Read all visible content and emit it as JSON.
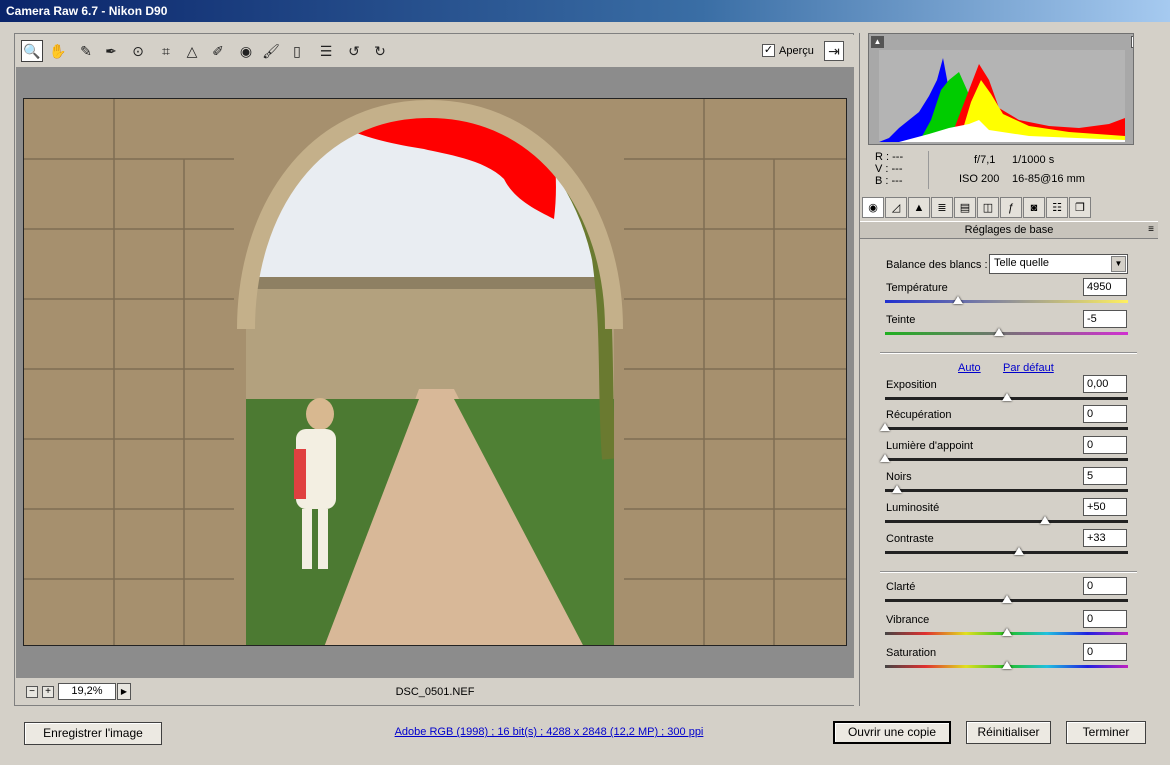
{
  "window": {
    "title": "Camera Raw 6.7  -  Nikon D90"
  },
  "toolbar": {
    "tools": [
      {
        "name": "zoom-tool-icon",
        "glyph": "🔍"
      },
      {
        "name": "hand-tool-icon",
        "glyph": "✋"
      },
      {
        "name": "white-balance-tool-icon",
        "glyph": "✎"
      },
      {
        "name": "color-sampler-tool-icon",
        "glyph": "✒"
      },
      {
        "name": "targeted-adjustment-tool-icon",
        "glyph": "⊙"
      },
      {
        "name": "crop-tool-icon",
        "glyph": "⌗"
      },
      {
        "name": "straighten-tool-icon",
        "glyph": "△"
      },
      {
        "name": "spot-removal-tool-icon",
        "glyph": "✐"
      },
      {
        "name": "red-eye-tool-icon",
        "glyph": "◉"
      },
      {
        "name": "adjustment-brush-icon",
        "glyph": "🖌"
      },
      {
        "name": "graduated-filter-icon",
        "glyph": "▯"
      },
      {
        "name": "preferences-icon",
        "glyph": "☰"
      },
      {
        "name": "rotate-left-icon",
        "glyph": "↺"
      },
      {
        "name": "rotate-right-icon",
        "glyph": "↻"
      }
    ],
    "preview_label": "Aperçu",
    "preview_checked": "✓"
  },
  "status": {
    "zoom": "19,2%",
    "filename": "DSC_0501.NEF"
  },
  "readouts": {
    "r": "R :   ---",
    "v": "V :   ---",
    "b": "B :   ---",
    "aperture": "f/7,1",
    "shutter": "1/1000 s",
    "iso": "ISO 200",
    "lens": "16-85@16 mm"
  },
  "panel": {
    "title": "Réglages de base",
    "wb_label": "Balance des blancs :",
    "wb_value": "Telle quelle",
    "auto": "Auto",
    "default": "Par défaut",
    "sliders": [
      {
        "label": "Température",
        "value": "4950",
        "pos": 0.3
      },
      {
        "label": "Teinte",
        "value": "-5",
        "pos": 0.47
      },
      {
        "label": "Exposition",
        "value": "0,00",
        "pos": 0.5
      },
      {
        "label": "Récupération",
        "value": "0",
        "pos": 0.0
      },
      {
        "label": "Lumière d'appoint",
        "value": "0",
        "pos": 0.0
      },
      {
        "label": "Noirs",
        "value": "5",
        "pos": 0.05
      },
      {
        "label": "Luminosité",
        "value": "+50",
        "pos": 0.66
      },
      {
        "label": "Contraste",
        "value": "+33",
        "pos": 0.55
      },
      {
        "label": "Clarté",
        "value": "0",
        "pos": 0.5
      },
      {
        "label": "Vibrance",
        "value": "0",
        "pos": 0.5
      },
      {
        "label": "Saturation",
        "value": "0",
        "pos": 0.5
      }
    ]
  },
  "footer": {
    "save": "Enregistrer l'image",
    "workflow": "Adobe RGB (1998) ; 16 bit(s) ; 4288 x 2848 (12,2 MP) ; 300 ppi",
    "open_copy": "Ouvrir une copie",
    "reset": "Réinitialiser",
    "done": "Terminer"
  }
}
